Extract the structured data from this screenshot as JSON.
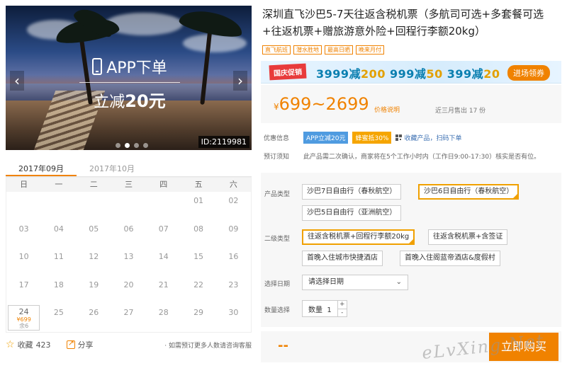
{
  "carousel": {
    "promo_line1": "APP下单",
    "promo_line2_prefix": "立减",
    "promo_line2_amount": "20元",
    "prev_icon": "‹",
    "next_icon": "›",
    "product_id": "ID:2119981",
    "dots": 4,
    "active_dot": 1
  },
  "calendar": {
    "tabs": [
      "2017年09月",
      "2017年10月"
    ],
    "active_tab": 0,
    "weekdays": [
      "日",
      "一",
      "二",
      "三",
      "四",
      "五",
      "六"
    ],
    "days": [
      "",
      "",
      "",
      "",
      "",
      "01",
      "02",
      "03",
      "04",
      "05",
      "06",
      "07",
      "08",
      "09",
      "10",
      "11",
      "12",
      "13",
      "14",
      "15",
      "16",
      "17",
      "18",
      "19",
      "20",
      "21",
      "22",
      "23",
      "24",
      "25",
      "26",
      "27",
      "28",
      "29",
      "30"
    ],
    "available_day": {
      "day": "24",
      "price": "¥699",
      "stock": "余6"
    }
  },
  "left_actions": {
    "favorite_icon": "☆",
    "favorite_label": "收藏",
    "favorite_count": "423",
    "share_label": "分享",
    "consult_text": "· 如需预订更多人数请咨询客服"
  },
  "product": {
    "title": "深圳直飞沙巴5-7天往返含税机票（多航司可选+多套餐可选+往返机票+赠旅游意外险+回程行李额20kg）",
    "tags": [
      "直飞航班",
      "潜水胜地",
      "最高日晒",
      "晚来月付"
    ]
  },
  "banner": {
    "badge": "国庆促销",
    "offers": [
      {
        "pre": "3999减",
        "hl": "200"
      },
      {
        "pre": "999减",
        "hl": "50"
      },
      {
        "pre": "399减",
        "hl": "20"
      }
    ],
    "button": "进场领券"
  },
  "price": {
    "currency": "¥",
    "range": "699~2699",
    "note": "价格说明",
    "sold": "近三月售出 17 份"
  },
  "promo_info": {
    "label": "优惠信息",
    "chip_app": "APP立减20元",
    "chip_honey": "蜂蜜抵30%",
    "qr_text": "收藏产品，扫码下单"
  },
  "booking": {
    "label": "预订须知",
    "text": "此产品需二次确认，商家将在5个工作小时内（工作日9:00-17:30）核实是否有位。"
  },
  "options": {
    "product_type_label": "产品类型",
    "product_types": [
      "沙巴7日自由行（春秋航空）",
      "沙巴6日自由行（春秋航空）",
      "沙巴5日自由行（亚洲航空）"
    ],
    "product_type_selected": 1,
    "sub_type_label": "二级类型",
    "sub_types": [
      "往返含税机票+回程行李额20kg",
      "往返含税机票+含签证",
      "首晚入住城市快捷酒店",
      "首晚入住阁蓝帝酒店&度假村"
    ],
    "sub_type_selected": 0,
    "date_label": "选择日期",
    "date_placeholder": "请选择日期",
    "date_chevron": "⌄",
    "qty_label": "数量选择",
    "qty_text": "数量",
    "qty_value": "1",
    "qty_plus": "+",
    "qty_minus": "-"
  },
  "buy": {
    "total": "--",
    "button": "立即购买"
  },
  "watermark": "eLvXing.Net"
}
